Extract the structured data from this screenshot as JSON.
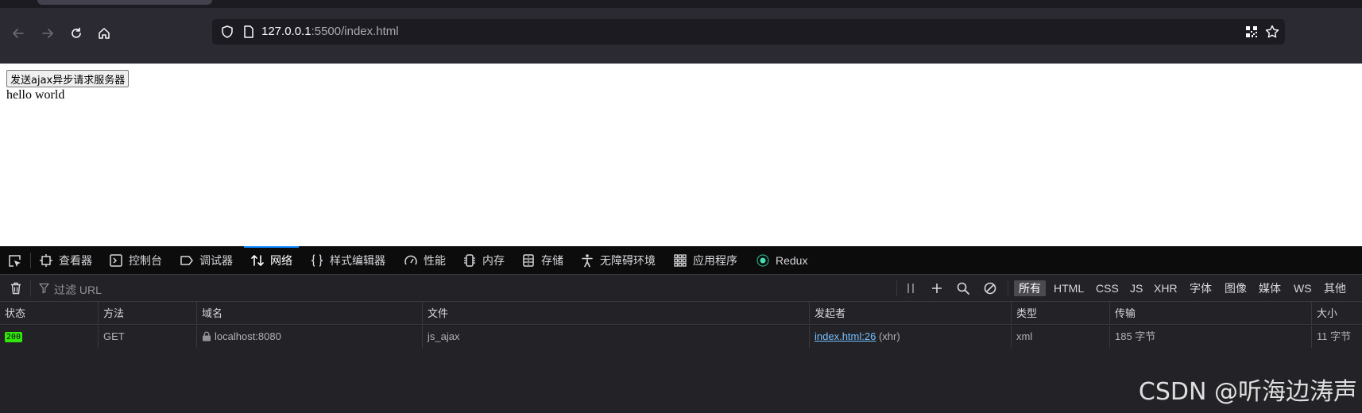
{
  "browser": {
    "url_host": "127.0.0.1",
    "url_rest": ":5500/index.html"
  },
  "page": {
    "button_label": "发送ajax异步请求服务器",
    "output_text": "hello world"
  },
  "devtools": {
    "tabs": [
      {
        "label": "查看器",
        "icon": "inspector-icon"
      },
      {
        "label": "控制台",
        "icon": "console-icon"
      },
      {
        "label": "调试器",
        "icon": "debugger-icon"
      },
      {
        "label": "网络",
        "icon": "network-icon",
        "active": true
      },
      {
        "label": "样式编辑器",
        "icon": "style-editor-icon"
      },
      {
        "label": "性能",
        "icon": "performance-icon"
      },
      {
        "label": "内存",
        "icon": "memory-icon"
      },
      {
        "label": "存储",
        "icon": "storage-icon"
      },
      {
        "label": "无障碍环境",
        "icon": "accessibility-icon"
      },
      {
        "label": "应用程序",
        "icon": "application-icon"
      },
      {
        "label": "Redux",
        "icon": "redux-icon"
      }
    ],
    "filter_placeholder": "过滤 URL",
    "type_filters": [
      "所有",
      "HTML",
      "CSS",
      "JS",
      "XHR",
      "字体",
      "图像",
      "媒体",
      "WS",
      "其他"
    ],
    "active_type_filter": "所有",
    "columns": [
      "状态",
      "方法",
      "域名",
      "文件",
      "发起者",
      "类型",
      "传输",
      "大小"
    ],
    "rows": [
      {
        "status": "200",
        "method": "GET",
        "domain": "localhost:8080",
        "file": "js_ajax",
        "initiator_link": "index.html:26",
        "initiator_type": "(xhr)",
        "type": "xml",
        "transferred": "185 字节",
        "size": "11 字节"
      }
    ]
  },
  "watermark": "CSDN @听海边涛声",
  "colors": {
    "accent": "#0a84ff",
    "status_ok": "#30e60b",
    "link": "#75bfff"
  }
}
